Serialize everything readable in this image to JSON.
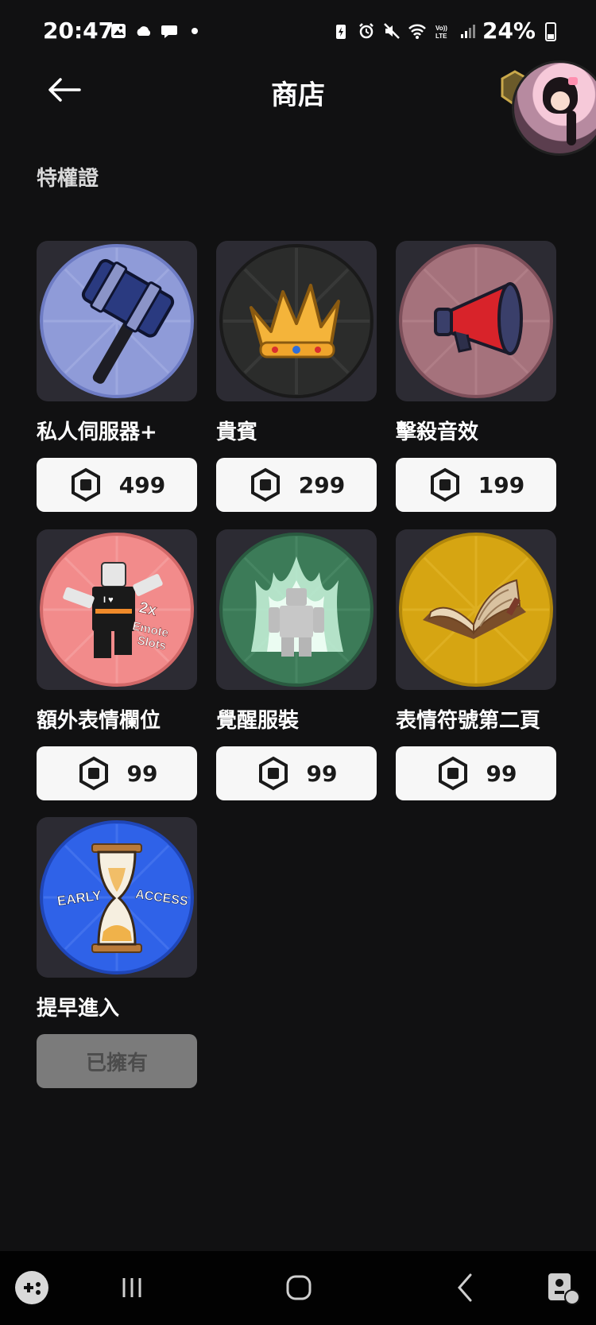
{
  "status_bar": {
    "time": "20:47",
    "battery_pct": "24%",
    "left_icons": [
      "image-icon",
      "cloud-icon",
      "chat-bubble-icon",
      "dot-icon"
    ],
    "right_icons": [
      "battery-saver-icon",
      "alarm-icon",
      "mute-icon",
      "wifi-icon",
      "volte-icon",
      "signal-icon"
    ]
  },
  "header": {
    "title": "商店"
  },
  "section_title": "特權證",
  "items": [
    {
      "label": "私人伺服器+",
      "price": "499",
      "bg": "#8f9bd8",
      "icon": "hammer-icon"
    },
    {
      "label": "貴賓",
      "price": "299",
      "bg": "#2b2c2b",
      "icon": "crown-icon"
    },
    {
      "label": "擊殺音效",
      "price": "199",
      "bg": "#a5727c",
      "icon": "megaphone-icon"
    },
    {
      "label": "額外表情欄位",
      "price": "99",
      "bg": "#f28b8b",
      "icon": "extra-emote-slots-icon",
      "icon_text": [
        "2x",
        "Emote",
        "Slots"
      ],
      "shirt_text": "I ♥"
    },
    {
      "label": "覺醒服裝",
      "price": "99",
      "bg": "#3c7b58",
      "icon": "aura-figure-icon"
    },
    {
      "label": "表情符號第二頁",
      "price": "99",
      "bg": "#d6a512",
      "icon": "book-icon"
    },
    {
      "label": "提早進入",
      "owned_text": "已擁有",
      "bg": "#2f62e8",
      "icon": "hourglass-icon",
      "icon_text_left": "EARLY",
      "icon_text_right": "ACCESS"
    }
  ],
  "colors": {
    "background": "#111112",
    "tile": "#2c2b33",
    "price_button": "#f7f7f7",
    "owned_button": "#7b7b7b"
  }
}
